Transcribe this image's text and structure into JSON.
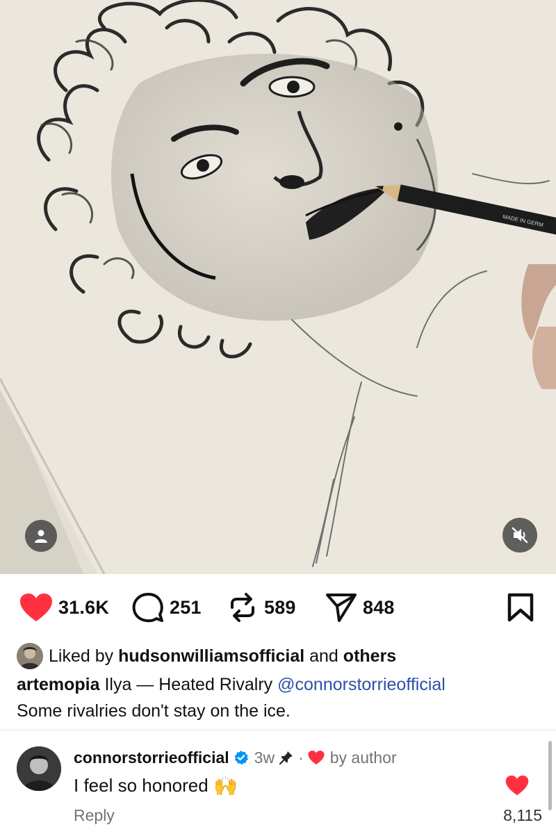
{
  "post": {
    "media": {
      "pencil_imprint": "MADE IN GERM",
      "tag_icon": "person-icon",
      "mute_icon": "speaker-muted-icon"
    },
    "actions": {
      "likes": "31.6K",
      "comments": "251",
      "reposts": "589",
      "shares": "848"
    },
    "liked_by": {
      "prefix": "Liked by",
      "user": "hudsonwilliamsofficial",
      "joiner": "and",
      "others": "others"
    },
    "caption": {
      "username": "artemopia",
      "text": "Ilya — Heated Rivalry",
      "mention": "@connorstorrieofficial",
      "line2": "Some rivalries don't stay on the ice."
    }
  },
  "comment": {
    "author": "connorstorrieofficial",
    "verified": true,
    "time": "3w",
    "separator": "·",
    "by_author": "by author",
    "text": "I feel so honored",
    "emoji": "🙌",
    "reply_label": "Reply",
    "like_count": "8,115"
  },
  "colors": {
    "like_red": "#ff3040",
    "verified_blue": "#0095f6",
    "mention_blue": "#2f4fa8",
    "muted_text": "#737373"
  }
}
